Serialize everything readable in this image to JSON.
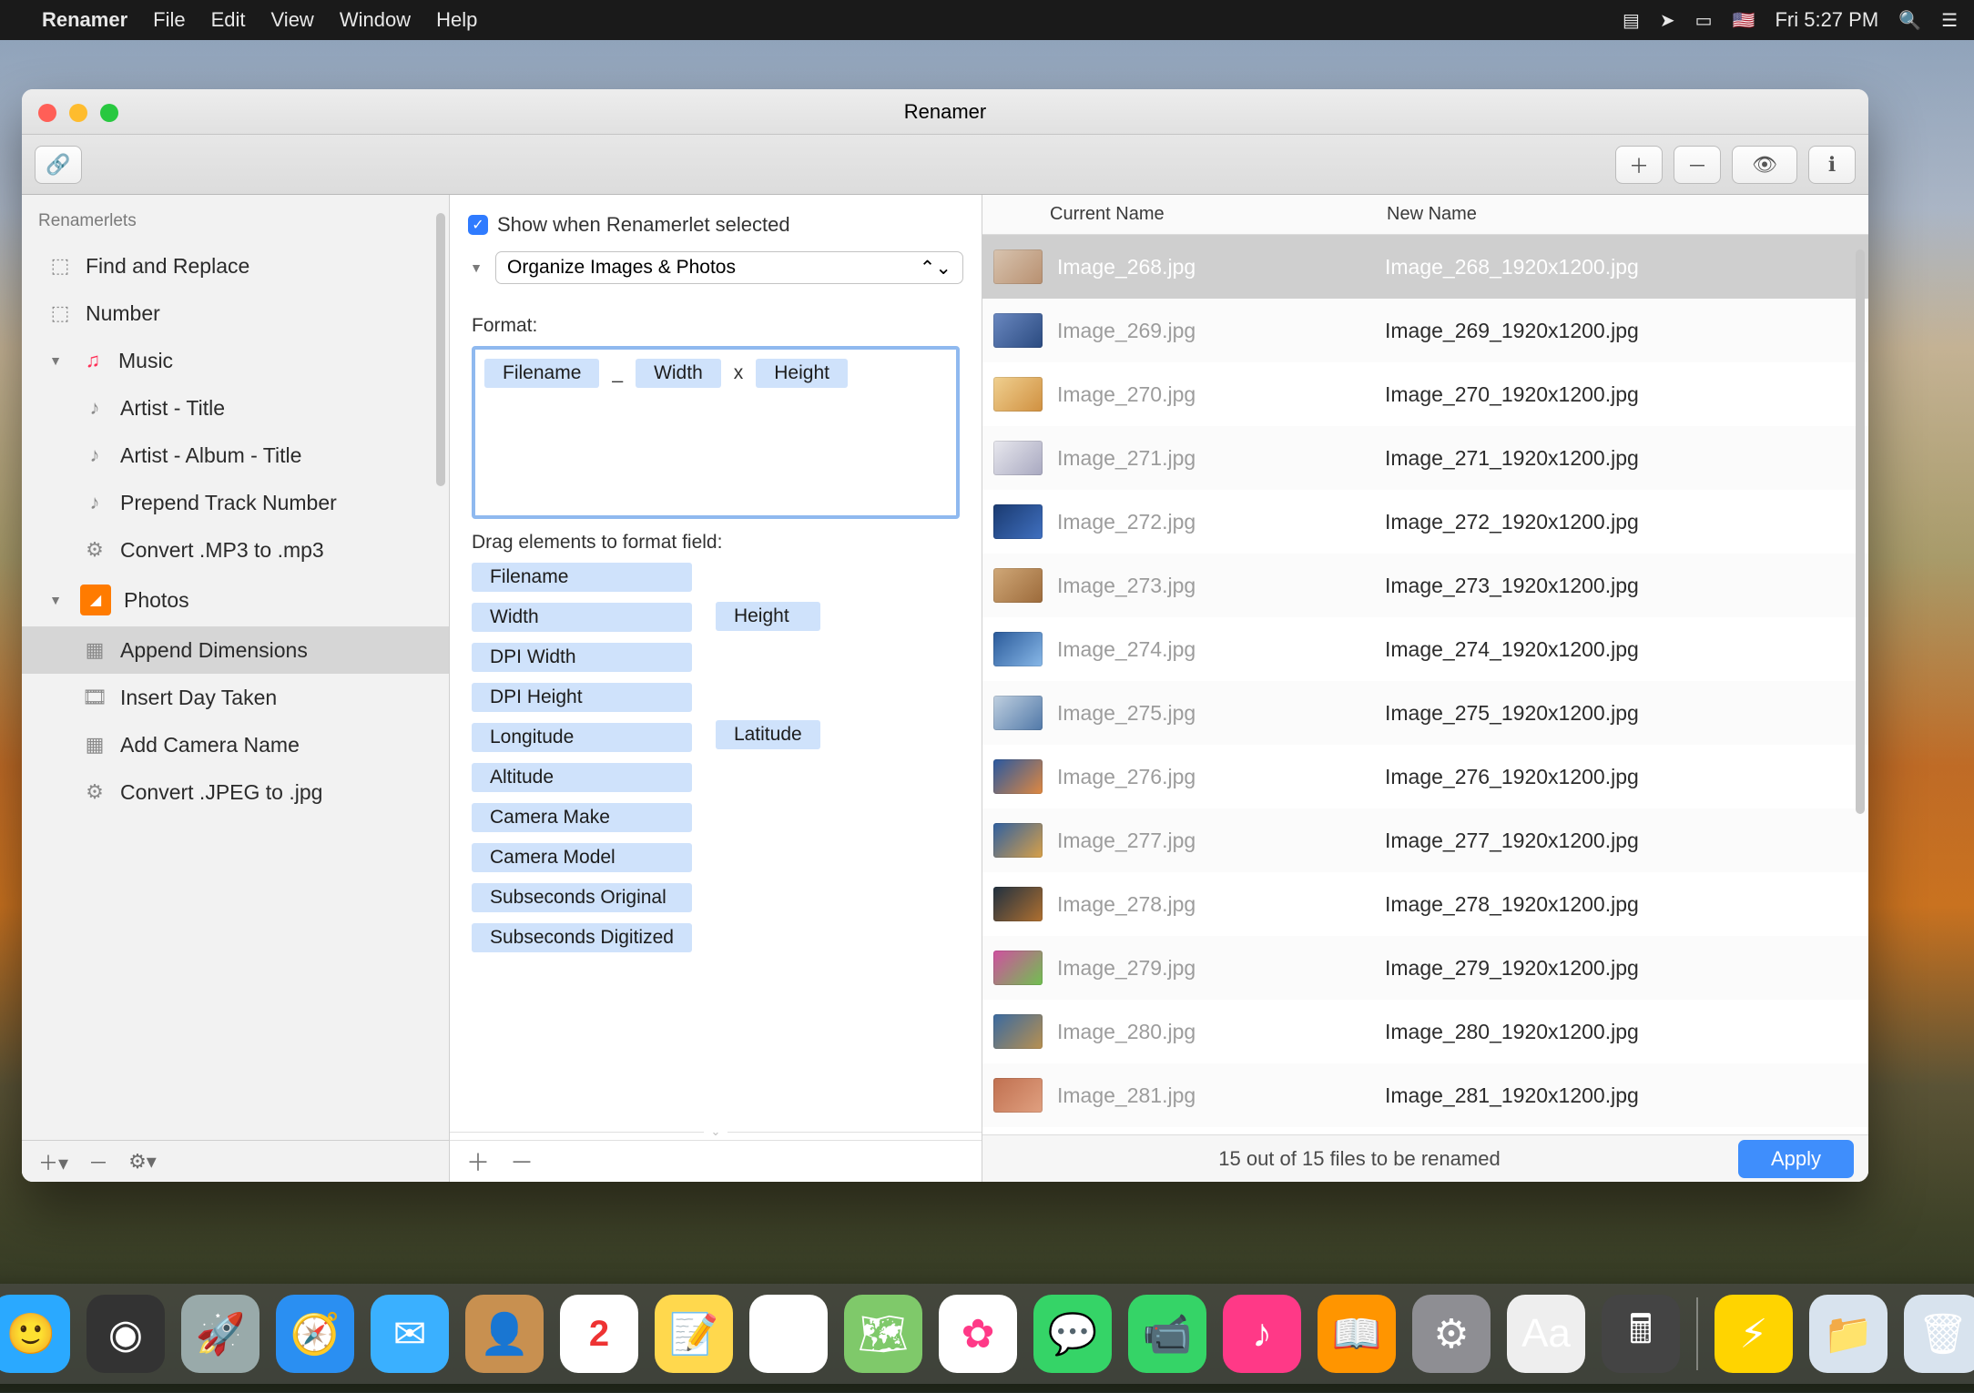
{
  "menubar": {
    "app": "Renamer",
    "items": [
      "File",
      "Edit",
      "View",
      "Window",
      "Help"
    ],
    "clock": "Fri 5:27 PM"
  },
  "window": {
    "title": "Renamer"
  },
  "sidebar": {
    "header": "Renamerlets",
    "items": [
      {
        "label": "Find and Replace",
        "icon": "cube",
        "type": "item"
      },
      {
        "label": "Number",
        "icon": "cube",
        "type": "item"
      },
      {
        "label": "Music",
        "icon": "music",
        "type": "group"
      },
      {
        "label": "Artist - Title",
        "icon": "note",
        "type": "child"
      },
      {
        "label": "Artist - Album - Title",
        "icon": "note",
        "type": "child"
      },
      {
        "label": "Prepend Track Number",
        "icon": "note",
        "type": "child"
      },
      {
        "label": "Convert .MP3 to .mp3",
        "icon": "gear",
        "type": "child"
      },
      {
        "label": "Photos",
        "icon": "photos",
        "type": "group"
      },
      {
        "label": "Append Dimensions",
        "icon": "image",
        "type": "child",
        "selected": true
      },
      {
        "label": "Insert Day Taken",
        "icon": "film",
        "type": "child"
      },
      {
        "label": "Add Camera Name",
        "icon": "image",
        "type": "child"
      },
      {
        "label": "Convert .JPEG to .jpg",
        "icon": "gear",
        "type": "child"
      }
    ]
  },
  "mid": {
    "show_checkbox_label": "Show when Renamerlet selected",
    "preset": "Organize Images & Photos",
    "format_label": "Format:",
    "format_tokens": [
      "Filename",
      "_",
      "Width",
      "x",
      "Height"
    ],
    "drag_label": "Drag elements to format field:",
    "palette_col1": [
      "Filename",
      "Width",
      "DPI Width",
      "DPI Height",
      "Longitude",
      "Altitude",
      "Camera Make",
      "Camera Model",
      "Subseconds Original",
      "Subseconds Digitized"
    ],
    "palette_col2": [
      "",
      "Height",
      "",
      "",
      "Latitude"
    ]
  },
  "table": {
    "col_current": "Current Name",
    "col_new": "New Name",
    "rows": [
      {
        "cur": "Image_268.jpg",
        "new": "Image_268_1920x1200.jpg",
        "selected": true
      },
      {
        "cur": "Image_269.jpg",
        "new": "Image_269_1920x1200.jpg"
      },
      {
        "cur": "Image_270.jpg",
        "new": "Image_270_1920x1200.jpg"
      },
      {
        "cur": "Image_271.jpg",
        "new": "Image_271_1920x1200.jpg"
      },
      {
        "cur": "Image_272.jpg",
        "new": "Image_272_1920x1200.jpg"
      },
      {
        "cur": "Image_273.jpg",
        "new": "Image_273_1920x1200.jpg"
      },
      {
        "cur": "Image_274.jpg",
        "new": "Image_274_1920x1200.jpg"
      },
      {
        "cur": "Image_275.jpg",
        "new": "Image_275_1920x1200.jpg"
      },
      {
        "cur": "Image_276.jpg",
        "new": "Image_276_1920x1200.jpg"
      },
      {
        "cur": "Image_277.jpg",
        "new": "Image_277_1920x1200.jpg"
      },
      {
        "cur": "Image_278.jpg",
        "new": "Image_278_1920x1200.jpg"
      },
      {
        "cur": "Image_279.jpg",
        "new": "Image_279_1920x1200.jpg"
      },
      {
        "cur": "Image_280.jpg",
        "new": "Image_280_1920x1200.jpg"
      },
      {
        "cur": "Image_281.jpg",
        "new": "Image_281_1920x1200.jpg"
      }
    ],
    "status": "15 out of 15 files to be renamed",
    "apply": "Apply"
  },
  "dock": {
    "apps": [
      "finder",
      "siri",
      "launchpad",
      "safari",
      "mail",
      "contacts",
      "calendar",
      "notes",
      "reminders",
      "maps",
      "photos",
      "messages",
      "facetime",
      "itunes",
      "ibooks",
      "preferences",
      "renamer",
      "calculator"
    ],
    "right": [
      "automator",
      "folder",
      "trash"
    ]
  }
}
